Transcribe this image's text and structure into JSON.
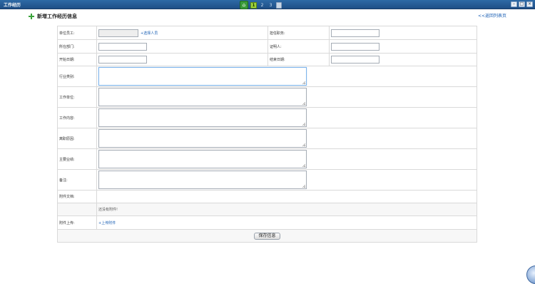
{
  "window": {
    "title": "工作经历"
  },
  "toolbar": {
    "pages": [
      "1",
      "2",
      "3"
    ]
  },
  "header": {
    "title": "新增工作经历信息",
    "back_link": "<<返回列表页"
  },
  "form": {
    "employee_label": "单位员工:",
    "employee_value": "",
    "select_person": "+选择人员",
    "position_label": "担任职务:",
    "position_value": "",
    "department_label": "所在部门:",
    "department_value": "",
    "witness_label": "证明人:",
    "witness_value": "",
    "start_date_label": "开始日期:",
    "start_date_value": "",
    "end_date_label": "结束日期:",
    "end_date_value": "",
    "industry_label": "行业类别:",
    "company_label": "工作单位:",
    "content_label": "工作内容:",
    "leave_reason_label": "离职原因:",
    "achievements_label": "主要业绩:",
    "remarks_label": "备注:",
    "attachments_label": "附件文档:",
    "no_attachments": "还没有附件!",
    "upload_label": "附件上传:",
    "upload_link": "+上传附件",
    "save_button": "保存信息"
  }
}
